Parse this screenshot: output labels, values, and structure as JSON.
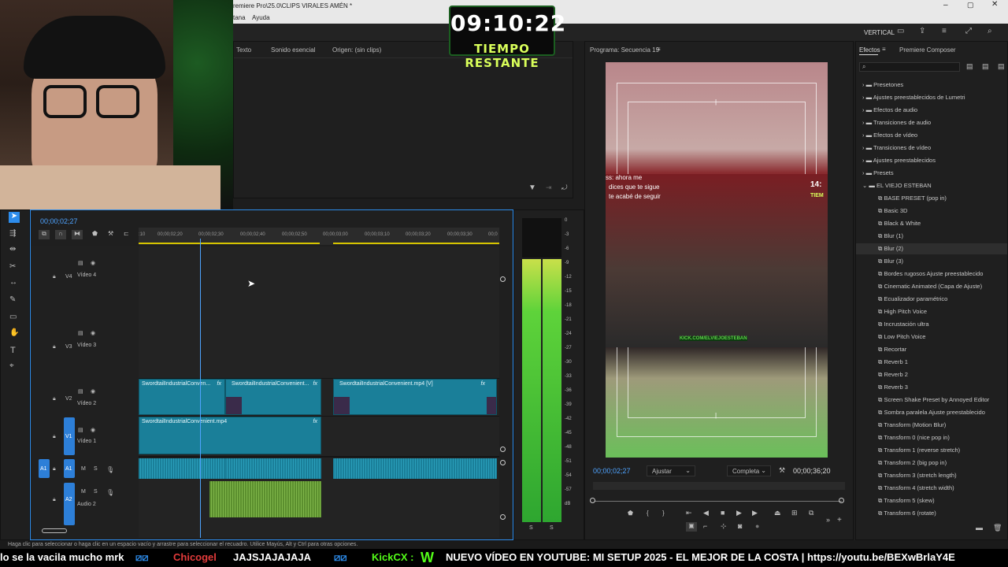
{
  "window": {
    "title": "remiere Pro\\25.0\\CLIPS VIRALES AMÉN *"
  },
  "menu": {
    "items": [
      "tana",
      "Ayuda"
    ]
  },
  "workspace": {
    "label": "VERTICAL"
  },
  "overlay": {
    "timer": "09:10:22",
    "timer_label": "TIEMPO RESTANTE"
  },
  "source_panel": {
    "tabs": [
      "Texto",
      "Sonido esencial",
      "Origen: (sin clips)"
    ]
  },
  "program": {
    "title": "Programa: Secuencia 19",
    "timecode": "00;00;02;27",
    "fit": "Ajustar",
    "quality": "Completa",
    "duration": "00;00;36;20",
    "caption_lines": [
      "ss: ahora me",
      "dices que te sigue",
      "te acabé de seguir"
    ],
    "overlay_corner": "14:",
    "overlay_corner2": "TIEM",
    "watermark": "KICK.COM/ELVIEJOESTEBAN"
  },
  "effects": {
    "tabs": [
      "Efectos",
      "Premiere Composer"
    ],
    "folders": [
      "Presetones",
      "Ajustes preestablecidos de Lumetri",
      "Efectos de audio",
      "Transiciones de audio",
      "Efectos de vídeo",
      "Transiciones de vídeo",
      "Ajustes preestablecidos",
      "Presets",
      "EL VIEJO ESTEBAN"
    ],
    "items": [
      "BASE PRESET (pop in)",
      "Basic 3D",
      "Black & White",
      "Blur (1)",
      "Blur (2)",
      "Blur (3)",
      "Bordes rugosos Ajuste preestablecido",
      "Cinematic Animated (Capa de Ajuste)",
      "Ecualizador paramétrico",
      "High Pitch Voice",
      "Incrustación ultra",
      "Low Pitch Voice",
      "Recortar",
      "Reverb 1",
      "Reverb 2",
      "Reverb 3",
      "Screen Shake Preset by Annoyed Editor",
      "Sombra paralela Ajuste preestablecido",
      "Transform (Motion Blur)",
      "Transform 0 (nice pop in)",
      "Transform 1 (reverse stretch)",
      "Transform 2 (big pop in)",
      "Transform 3 (stretch length)",
      "Transform 4 (stretch width)",
      "Transform 5 (skew)",
      "Transform 6 (rotate)"
    ]
  },
  "timeline": {
    "timecode": "00;00;02;27",
    "ruler": [
      "00;00;02;20",
      "00;00;02;30",
      "00;00;02;40",
      "00;00;02;50",
      "00;00;03;00",
      "00;00;03;10",
      "00;00;03;20",
      "00;00;03;30",
      "00;0"
    ],
    "ruler_start": ":10",
    "tracks": {
      "v4": {
        "id": "V4",
        "name": "Vídeo 4"
      },
      "v3": {
        "id": "V3",
        "name": "Vídeo 3"
      },
      "v2": {
        "id": "V2",
        "name": "Vídeo 2"
      },
      "v1": {
        "id": "V1",
        "name": "Vídeo 1"
      },
      "a1": {
        "id": "A1",
        "src": "A1",
        "name": ""
      },
      "a2": {
        "id": "A2",
        "name": "Audio 2"
      }
    },
    "clips": {
      "v2a": "SwordtailIndustrialConven...",
      "v2b": "SwordtailIndustrialConvenient...",
      "v2c": "SwordtailIndustrialConvenient.mp4 [V]",
      "v1a": "SwordtailIndustrialConvenient.mp4"
    },
    "fx": "fx"
  },
  "meter": {
    "scale": [
      "0",
      "-3",
      "-6",
      "-9",
      "-12",
      "-15",
      "-18",
      "-21",
      "-24",
      "-27",
      "-30",
      "-33",
      "-36",
      "-39",
      "-42",
      "-45",
      "-48",
      "-51",
      "-54",
      "-57",
      "dB"
    ],
    "channels": [
      "S",
      "S"
    ]
  },
  "status": {
    "hint": "Haga clic para seleccionar o haga clic en un espacio vacío y arrastre para seleccionar el recuadro. Utilice Mayús, Alt y Ctrl para otras opciones."
  },
  "ticker": {
    "p1": "lo se la vacila mucho mrk",
    "p2": "Chicogel",
    "p3": "JAJSJAJAJAJA",
    "p4": "KickCX :",
    "p5": "W",
    "p6": "NUEVO VÍDEO EN YOUTUBE: MI SETUP 2025 - EL MEJOR DE LA COSTA | https://youtu.be/BEXwBrlaY4E"
  },
  "colors": {
    "accent": "#2d8ceb",
    "clip": "#1a7f99",
    "audio_green": "#5b8f2e",
    "timer_green": "#d9ff5a"
  }
}
